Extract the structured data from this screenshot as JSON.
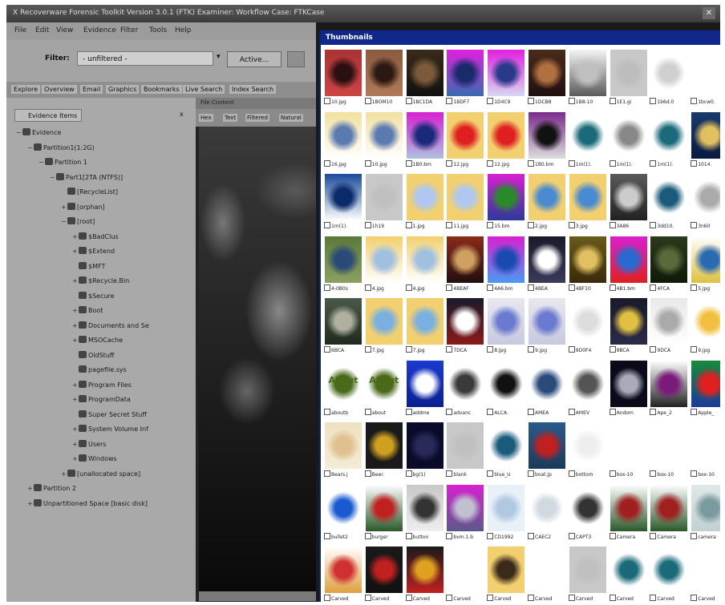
{
  "window": {
    "title": "X  Recoverware Forensic Toolkit Version 3.0.1 (FTK) Examiner: Workflow Case: FTKCase",
    "close_glyph": "✕"
  },
  "menu": [
    "File",
    "Edit",
    "View",
    "Evidence",
    "Filter",
    "Tools",
    "Help"
  ],
  "toolbar": {
    "filter_label": "Filter:",
    "filter_value": "- unfiltered -",
    "active_button": "Active..."
  },
  "tabs": [
    "Explore",
    "Overview",
    "Email",
    "Graphics",
    "Bookmarks",
    "Live Search",
    "Index Search"
  ],
  "evidence_panel": {
    "tab_label": "Evidence Items",
    "close_glyph": "x",
    "tree": [
      {
        "label": "Evidence",
        "level": 0,
        "expander": "−"
      },
      {
        "label": "Partition1(1:2G)",
        "level": 1,
        "expander": "−"
      },
      {
        "label": "Partition 1",
        "level": 2,
        "expander": "−"
      },
      {
        "label": "Part1[2TA (NTFS)]",
        "level": 3,
        "expander": "−"
      },
      {
        "label": "[RecycleList]",
        "level": 4,
        "expander": ""
      },
      {
        "label": "[orphan]",
        "level": 4,
        "expander": "+"
      },
      {
        "label": "[root]",
        "level": 4,
        "expander": "−"
      },
      {
        "label": "$BadClus",
        "level": 5,
        "expander": "+"
      },
      {
        "label": "$Extend",
        "level": 5,
        "expander": "+"
      },
      {
        "label": "$MFT",
        "level": 5,
        "expander": ""
      },
      {
        "label": "$Recycle.Bin",
        "level": 5,
        "expander": "+"
      },
      {
        "label": "$Secure",
        "level": 5,
        "expander": ""
      },
      {
        "label": "Boot",
        "level": 5,
        "expander": "+"
      },
      {
        "label": "Documents and Se",
        "level": 5,
        "expander": "+"
      },
      {
        "label": "MSOCache",
        "level": 5,
        "expander": "+"
      },
      {
        "label": "OldStuff",
        "level": 5,
        "expander": ""
      },
      {
        "label": "pagefile.sys",
        "level": 5,
        "expander": ""
      },
      {
        "label": "Program Files",
        "level": 5,
        "expander": "+"
      },
      {
        "label": "ProgramData",
        "level": 5,
        "expander": "+"
      },
      {
        "label": "Super Secret Stuff",
        "level": 5,
        "expander": ""
      },
      {
        "label": "System Volume Inf",
        "level": 5,
        "expander": "+"
      },
      {
        "label": "Users",
        "level": 5,
        "expander": "+"
      },
      {
        "label": "Windows",
        "level": 5,
        "expander": "+"
      },
      {
        "label": "[unallocated space]",
        "level": 4,
        "expander": "+"
      },
      {
        "label": "Partition 2",
        "level": 1,
        "expander": "+"
      },
      {
        "label": "Unpartitioned Space [basic disk]",
        "level": 1,
        "expander": "+"
      }
    ]
  },
  "viewer": {
    "header": "File Content",
    "tabs": [
      "Hex",
      "Text",
      "Filtered",
      "Natural"
    ]
  },
  "thumbnails": {
    "title": "Thumbnails",
    "items": [
      {
        "label": "10.jpg",
        "colors": [
          "#a33",
          "#2a1010",
          "#c44"
        ]
      },
      {
        "label": "1BOM10",
        "colors": [
          "#8a5a40",
          "#2b1a12",
          "#b07a5a"
        ]
      },
      {
        "label": "1BC1DA",
        "colors": [
          "#3a2a1a",
          "#7a5a3a",
          "#111"
        ]
      },
      {
        "label": "1BDF7",
        "colors": [
          "#e020e0",
          "#1a2a6a",
          "#3a6ab0"
        ]
      },
      {
        "label": "1D4C9",
        "colors": [
          "#e020e0",
          "#2a3a8a",
          "#d8d8f0"
        ]
      },
      {
        "label": "1DCB8",
        "colors": [
          "#4a2a1a",
          "#b07040",
          "#201010"
        ]
      },
      {
        "label": "1B8-10",
        "colors": [
          "#f4f4f4",
          "#c0c0c0",
          "#5a5a5a"
        ]
      },
      {
        "label": "1E1.gi",
        "colors": [
          "#c8c8c8",
          "#bdbdbd",
          "#c8c8c8"
        ]
      },
      {
        "label": "1b6d.0",
        "colors": [
          "#ffffff",
          "#d0d0d0",
          "#ffffff"
        ]
      },
      {
        "label": "1bcw0.",
        "colors": [
          "#ffffff",
          "#ffffff",
          "#ffffff"
        ]
      },
      {
        "label": "16.jpg",
        "colors": [
          "#f2e0a0",
          "#5a7ab0",
          "#fff"
        ]
      },
      {
        "label": "10.jpg",
        "colors": [
          "#f2e0a0",
          "#5a7ab0",
          "#fff"
        ]
      },
      {
        "label": "1B0.bm",
        "colors": [
          "#d820d0",
          "#1a2a7a",
          "#b0c0e0"
        ]
      },
      {
        "label": "12.jpg",
        "colors": [
          "#f2d070",
          "#e02020",
          "#f2d070"
        ]
      },
      {
        "label": "12.jpg",
        "colors": [
          "#f2d070",
          "#e02020",
          "#f2d070"
        ]
      },
      {
        "label": "1B0.bm",
        "colors": [
          "#7a2a8a",
          "#111",
          "#ddd"
        ]
      },
      {
        "label": "1m(1).",
        "colors": [
          "#ffffff",
          "#1a6a7a",
          "#ffffff"
        ]
      },
      {
        "label": "1m(1).",
        "colors": [
          "#ffffff",
          "#888",
          "#ffffff"
        ]
      },
      {
        "label": "1m(1).",
        "colors": [
          "#ffffff",
          "#1a6a7a",
          "#ffffff"
        ]
      },
      {
        "label": "1014.",
        "colors": [
          "#1a3a6a",
          "#e0c060",
          "#0a1a40"
        ]
      },
      {
        "label": "1m(1).",
        "colors": [
          "#1a4a9a",
          "#0a2a6a",
          "#fff"
        ]
      },
      {
        "label": "1h19",
        "colors": [
          "#c8c8c8",
          "#c0c0c0",
          "#c8c8c8"
        ]
      },
      {
        "label": "1.jpg",
        "colors": [
          "#f2d070",
          "#b0c8f0",
          "#f2d070"
        ]
      },
      {
        "label": "11.jpg",
        "colors": [
          "#f2d070",
          "#b0c8f0",
          "#f2d070"
        ]
      },
      {
        "label": "15.bm",
        "colors": [
          "#d820d0",
          "#2a8a2a",
          "#2a3a9a"
        ]
      },
      {
        "label": "2.jpg",
        "colors": [
          "#f2d070",
          "#4a8ad0",
          "#f2d070"
        ]
      },
      {
        "label": "3.jpg",
        "colors": [
          "#f2d070",
          "#4a8ad0",
          "#f2d070"
        ]
      },
      {
        "label": "3A86",
        "colors": [
          "#5a5a5a",
          "#ccc",
          "#222"
        ]
      },
      {
        "label": "3dd10.",
        "colors": [
          "#ffffff",
          "#1a5a7a",
          "#ffffff"
        ]
      },
      {
        "label": "3n60",
        "colors": [
          "#ffffff",
          "#aaa",
          "#ffffff"
        ]
      },
      {
        "label": "4-0B0s",
        "colors": [
          "#5a7a3a",
          "#2a4a7a",
          "#8aa060"
        ]
      },
      {
        "label": "4.jpg",
        "colors": [
          "#f2d070",
          "#a0c0e0",
          "#fff"
        ]
      },
      {
        "label": "4.jpg",
        "colors": [
          "#f2d070",
          "#a0c0e0",
          "#fff"
        ]
      },
      {
        "label": "4BEAF",
        "colors": [
          "#8a2a1a",
          "#d0a060",
          "#201010"
        ]
      },
      {
        "label": "4A6.bm",
        "colors": [
          "#d820d0",
          "#1a4ab0",
          "#4a9af0"
        ]
      },
      {
        "label": "4BEA",
        "colors": [
          "#1a1a2a",
          "#fff",
          "#3a3a5a"
        ]
      },
      {
        "label": "4BF10",
        "colors": [
          "#6a5a1a",
          "#e0c060",
          "#3a2a0a"
        ]
      },
      {
        "label": "4B1.bm",
        "colors": [
          "#d820d0",
          "#2a6ad0",
          "#e02020"
        ]
      },
      {
        "label": "4FCA",
        "colors": [
          "#2a3a1a",
          "#5a6a3a",
          "#101a08"
        ]
      },
      {
        "label": "5.jpg",
        "colors": [
          "#ffffff",
          "#2a6ab0",
          "#e0c040"
        ]
      },
      {
        "label": "6BCA",
        "colors": [
          "#4a5a4a",
          "#b0b0a0",
          "#202a20"
        ]
      },
      {
        "label": "7.jpg",
        "colors": [
          "#f2d070",
          "#7ab0e0",
          "#f2d070"
        ]
      },
      {
        "label": "7.jpg",
        "colors": [
          "#f2d070",
          "#7ab0e0",
          "#f2d070"
        ]
      },
      {
        "label": "7DCA",
        "colors": [
          "#1a1a2a",
          "#fff",
          "#8a1a1a"
        ]
      },
      {
        "label": "8.jpg",
        "colors": [
          "#e8e8f0",
          "#6a7ad0",
          "#c8c8e0"
        ]
      },
      {
        "label": "9.jpg",
        "colors": [
          "#e8e8f0",
          "#6a7ad0",
          "#c8c8e0"
        ]
      },
      {
        "label": "9D0F4",
        "colors": [
          "#ffffff",
          "#ddd",
          "#ffffff"
        ]
      },
      {
        "label": "9BCA",
        "colors": [
          "#1a1a2a",
          "#e0c040",
          "#2a2a4a"
        ]
      },
      {
        "label": "9DCA",
        "colors": [
          "#e8e8e8",
          "#aaa",
          "#fff"
        ]
      },
      {
        "label": "9.jpg",
        "colors": [
          "#ffffff",
          "#f2c040",
          "#ffffff"
        ]
      },
      {
        "label": "aboutb",
        "text": "About",
        "colors": [
          "#ffffff",
          "#4a6a1a",
          "#ffffff"
        ]
      },
      {
        "label": "about",
        "text": "About",
        "colors": [
          "#ffffff",
          "#4a6a1a",
          "#ffffff"
        ]
      },
      {
        "label": "addme",
        "text": "+",
        "colors": [
          "#1a3ad0",
          "#ffffff",
          "#0a2090"
        ]
      },
      {
        "label": "advanc",
        "colors": [
          "#ffffff",
          "#3a3a3a",
          "#ffffff"
        ]
      },
      {
        "label": "ALCA.",
        "colors": [
          "#ffffff",
          "#111",
          "#ffffff"
        ]
      },
      {
        "label": "AMEA",
        "colors": [
          "#ffffff",
          "#2a4a7a",
          "#ffffff"
        ]
      },
      {
        "label": "AMEV",
        "colors": [
          "#ffffff",
          "#555",
          "#ffffff"
        ]
      },
      {
        "label": "Andom",
        "colors": [
          "#0a0a1a",
          "#aab",
          "#0a0a1a"
        ]
      },
      {
        "label": "Ape_2",
        "colors": [
          "#ffffff",
          "#7a1a7a",
          "#222"
        ]
      },
      {
        "label": "Apple_",
        "colors": [
          "#1a8a3a",
          "#e02020",
          "#1a3a9a"
        ]
      },
      {
        "label": "Bears.j",
        "colors": [
          "#f0e0c0",
          "#e0c090",
          "#f4ecd8"
        ]
      },
      {
        "label": "Beer.",
        "colors": [
          "#1a1a1a",
          "#d0a020",
          "#1a1a1a"
        ]
      },
      {
        "label": "bg(1)",
        "colors": [
          "#0a0a2a",
          "#2a2a5a",
          "#0a0a2a"
        ]
      },
      {
        "label": "blank",
        "colors": [
          "#c8c8c8",
          "#c0c0c0",
          "#c8c8c8"
        ]
      },
      {
        "label": "blue_U",
        "colors": [
          "#ffffff",
          "#1a5a7a",
          "#ffffff"
        ]
      },
      {
        "label": "boat.jp",
        "colors": [
          "#2a5a8a",
          "#c02020",
          "#1a3a5a"
        ]
      },
      {
        "label": "bottom",
        "colors": [
          "#ffffff",
          "#eee",
          "#ffffff"
        ]
      },
      {
        "label": "box-10",
        "colors": [
          "#ffffff",
          "#ffffff",
          "#ffffff"
        ]
      },
      {
        "label": "box-10",
        "colors": [
          "#ffffff",
          "#ffffff",
          "#ffffff"
        ]
      },
      {
        "label": "box-10",
        "colors": [
          "#ffffff",
          "#ffffff",
          "#ffffff"
        ]
      },
      {
        "label": "bullet2",
        "colors": [
          "#ffffff",
          "#1a5ad0",
          "#ffffff"
        ]
      },
      {
        "label": "burger",
        "colors": [
          "#ffffff",
          "#c02020",
          "#2a5a2a"
        ]
      },
      {
        "label": "button",
        "colors": [
          "#c8c8c8",
          "#333",
          "#eee"
        ]
      },
      {
        "label": "bvm.1.b",
        "colors": [
          "#d820d0",
          "#c0c0d0",
          "#5a5a8a"
        ]
      },
      {
        "label": "CD1992",
        "colors": [
          "#e8f0f8",
          "#b0c8e0",
          "#e8f0f8"
        ]
      },
      {
        "label": "CAEC2",
        "colors": [
          "#ffffff",
          "#d0d8e0",
          "#ffffff"
        ]
      },
      {
        "label": "CAPT3",
        "colors": [
          "#ffffff",
          "#333",
          "#ffffff"
        ]
      },
      {
        "label": "Camera",
        "colors": [
          "#ffffff",
          "#a02020",
          "#2a5a2a"
        ]
      },
      {
        "label": "Camera",
        "colors": [
          "#ffffff",
          "#a02020",
          "#2a5a2a"
        ]
      },
      {
        "label": "camera",
        "colors": [
          "#e0e8e8",
          "#7a9aa0",
          "#c0d0d0"
        ]
      },
      {
        "label": "Carved",
        "colors": [
          "#ffffff",
          "#d03030",
          "#e0a040"
        ]
      },
      {
        "label": "Carved",
        "colors": [
          "#1a1a1a",
          "#c02020",
          "#111"
        ]
      },
      {
        "label": "Carved",
        "colors": [
          "#1a1a1a",
          "#e0a020",
          "#c02020"
        ]
      },
      {
        "label": "Carved",
        "colors": [
          "#ffffff",
          "#ffffff",
          "#ffffff"
        ]
      },
      {
        "label": "Carved",
        "colors": [
          "#f2d070",
          "#3a2a1a",
          "#f2d070"
        ]
      },
      {
        "label": "Carved",
        "colors": [
          "#ffffff",
          "#ffffff",
          "#ffffff"
        ]
      },
      {
        "label": "Carved",
        "colors": [
          "#c8c8c8",
          "#c0c0c0",
          "#c8c8c8"
        ]
      },
      {
        "label": "Carved",
        "colors": [
          "#ffffff",
          "#1a6a7a",
          "#ffffff"
        ]
      },
      {
        "label": "Carved",
        "colors": [
          "#ffffff",
          "#1a6a7a",
          "#ffffff"
        ]
      },
      {
        "label": "Carved",
        "colors": [
          "#ffffff",
          "#ffffff",
          "#ffffff"
        ]
      }
    ]
  }
}
